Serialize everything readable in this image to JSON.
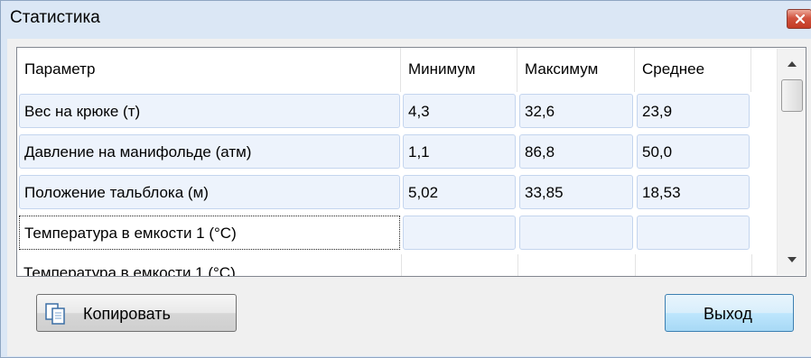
{
  "window": {
    "title": "Статистика"
  },
  "table": {
    "columns": [
      "Параметр",
      "Минимум",
      "Максимум",
      "Среднее"
    ],
    "rows": [
      {
        "param": "Вес на крюке (т)",
        "min": "4,3",
        "max": "32,6",
        "avg": "23,9"
      },
      {
        "param": "Давление на манифольде (атм)",
        "min": "1,1",
        "max": "86,8",
        "avg": "50,0"
      },
      {
        "param": "Положение тальблока (м)",
        "min": "5,02",
        "max": "33,85",
        "avg": "18,53"
      },
      {
        "param": "Температура в емкости 1 (°C)",
        "min": "",
        "max": "",
        "avg": ""
      },
      {
        "param": "Температура в емкости 1 (°C)",
        "min": "",
        "max": "",
        "avg": ""
      }
    ]
  },
  "buttons": {
    "copy": "Копировать",
    "exit": "Выход"
  },
  "icons": {
    "close": "close-icon",
    "copy": "copy-icon",
    "scroll_up": "scroll-up-arrow-icon",
    "scroll_down": "scroll-down-arrow-icon"
  },
  "colors": {
    "title_bg": "#dbe7f5",
    "close_btn": "#c43b24",
    "cell_bg": "#edf3fc",
    "cell_border": "#c4d5ee",
    "primary_border": "#3c7fb1"
  }
}
